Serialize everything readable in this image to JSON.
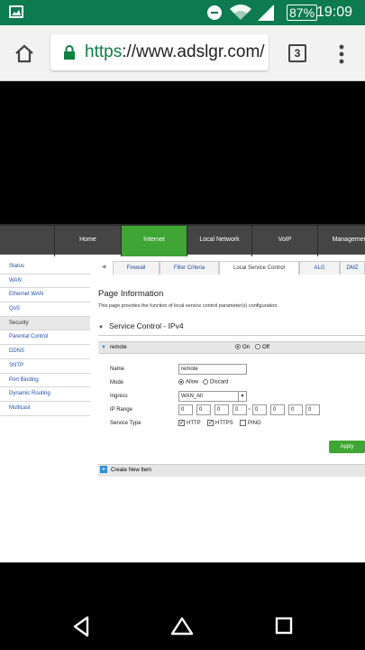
{
  "status_bar": {
    "time": "19:09",
    "battery_pct": "87%"
  },
  "browser": {
    "url_scheme": "https",
    "url_rest": "://www.adslgr.com/",
    "tab_count": "3"
  },
  "router": {
    "topnav": [
      "Home",
      "Internet",
      "Local Network",
      "VoIP",
      "Management"
    ],
    "sidebar": [
      "Status",
      "WAN",
      "Ethernet WAN",
      "QoS",
      "Security",
      "Parental Control",
      "DDNS",
      "SNTP",
      "Port Binding",
      "Dynamic Routing",
      "Multicast"
    ],
    "tabs": [
      "Firewall",
      "Filter Criteria",
      "Local Service Control",
      "ALG",
      "DMZ"
    ],
    "page_title": "Page Information",
    "page_desc": "This page provides the function of local service control parameter(s) configuration.",
    "section_title": "Service Control - IPv4",
    "entry": {
      "name": "remote",
      "on_label": "On",
      "off_label": "Off",
      "fields": {
        "name_label": "Name",
        "name_value": "remote",
        "mode_label": "Mode",
        "mode_allow": "Allow",
        "mode_discard": "Discard",
        "ingress_label": "Ingress",
        "ingress_value": "WAN_All",
        "iprange_label": "IP Range",
        "ip_start": [
          "0",
          "0",
          "0",
          "0"
        ],
        "ip_sep": "~",
        "ip_end": [
          "0",
          "0",
          "0",
          "0"
        ],
        "servicetype_label": "Service Type",
        "svc_http": "HTTP",
        "svc_https": "HTTPS",
        "svc_ping": "PING"
      }
    },
    "apply_label": "Apply",
    "create_label": "Create New Item"
  },
  "colors": {
    "status_bar": "#0d7a50",
    "nav_active": "#3fa635",
    "nav_bg": "#454545",
    "link": "#1f4fa0"
  }
}
